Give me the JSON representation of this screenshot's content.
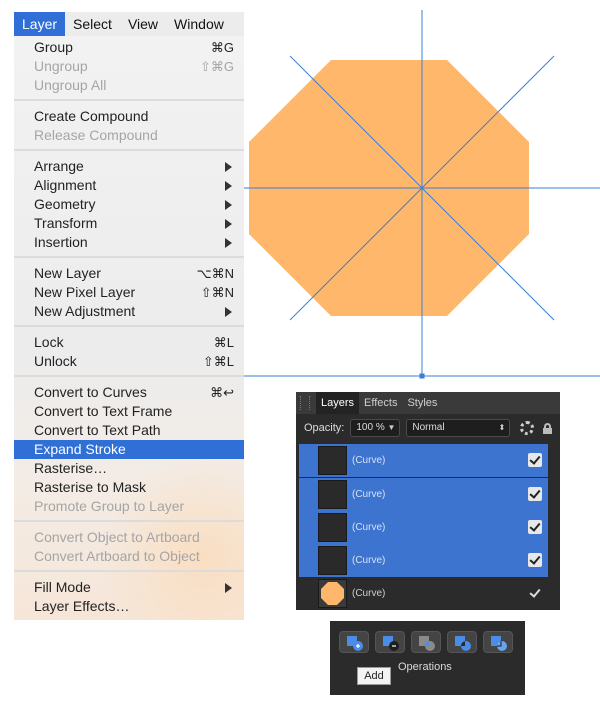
{
  "menubar": {
    "items": [
      "Layer",
      "Select",
      "View",
      "Window"
    ],
    "active": "Layer"
  },
  "menu": {
    "group": "Group",
    "group_sc": "⌘G",
    "ungroup": "Ungroup",
    "ungroup_sc": "⇧⌘G",
    "ungroup_all": "Ungroup All",
    "create_compound": "Create Compound",
    "release_compound": "Release Compound",
    "arrange": "Arrange",
    "alignment": "Alignment",
    "geometry": "Geometry",
    "transform": "Transform",
    "insertion": "Insertion",
    "new_layer": "New Layer",
    "new_layer_sc": "⌥⌘N",
    "new_pixel_layer": "New Pixel Layer",
    "new_pixel_layer_sc": "⇧⌘N",
    "new_adjustment": "New Adjustment",
    "lock": "Lock",
    "lock_sc": "⌘L",
    "unlock": "Unlock",
    "unlock_sc": "⇧⌘L",
    "convert_curves": "Convert to Curves",
    "convert_curves_sc": "⌘↩",
    "convert_text_frame": "Convert to Text Frame",
    "convert_text_path": "Convert to Text Path",
    "expand_stroke": "Expand Stroke",
    "rasterise": "Rasterise…",
    "rasterise_mask": "Rasterise to Mask",
    "promote_group": "Promote Group to Layer",
    "convert_obj_artboard": "Convert Object to Artboard",
    "convert_artboard_obj": "Convert Artboard to Object",
    "fill_mode": "Fill Mode",
    "layer_effects": "Layer Effects…"
  },
  "canvas": {
    "shape": "octagon",
    "fill_color": "#ffb86b",
    "guide_color": "#3d7fd6"
  },
  "layers_panel": {
    "tabs": [
      "Layers",
      "Effects",
      "Styles"
    ],
    "active_tab": "Layers",
    "opacity_label": "Opacity:",
    "opacity_value": "100 %",
    "blend_mode": "Normal",
    "rows": [
      {
        "name": "(Curve)",
        "selected": true,
        "visible": true
      },
      {
        "name": "(Curve)",
        "selected": true,
        "visible": true
      },
      {
        "name": "(Curve)",
        "selected": true,
        "visible": true
      },
      {
        "name": "(Curve)",
        "selected": true,
        "visible": true
      },
      {
        "name": "(Curve)",
        "selected": false,
        "visible": true
      }
    ],
    "selected_color": "#3c74cf"
  },
  "operations": {
    "label": "Operations",
    "tooltip": "Add",
    "buttons": [
      "add-icon",
      "subtract-icon",
      "intersect-icon",
      "xor-icon",
      "divide-icon"
    ]
  }
}
